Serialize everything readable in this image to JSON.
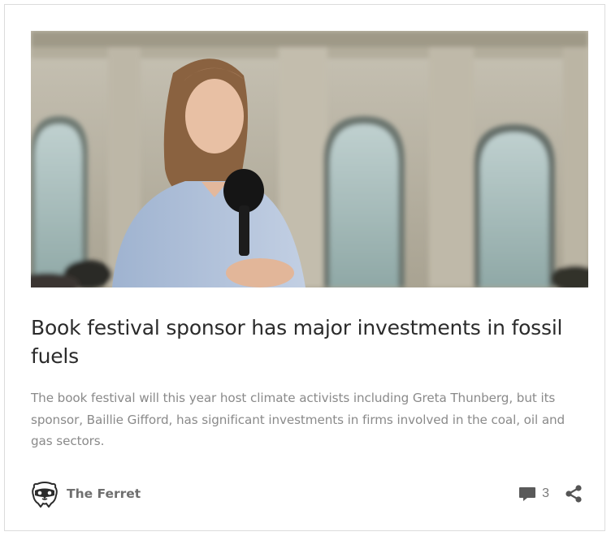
{
  "post": {
    "image_alt": "Climate activist speaking into a microphone in front of a building",
    "headline": "Book festival sponsor has major investments in fossil fuels",
    "excerpt": "The book festival will this year host climate activists including Greta Thunberg, but its sponsor, Baillie Gifford, has significant investments in firms involved in the coal, oil and gas sectors.",
    "author": {
      "name": "The Ferret",
      "avatar_icon": "ferret-logo-icon"
    },
    "comments": {
      "count": "3",
      "icon": "comment-bubble-icon"
    },
    "share_icon": "share-icon"
  },
  "colors": {
    "headline": "#2b2b2b",
    "excerpt": "#8a8a8a",
    "author": "#6f6f6f",
    "icons": "#555555",
    "border": "#dcdcdc"
  }
}
